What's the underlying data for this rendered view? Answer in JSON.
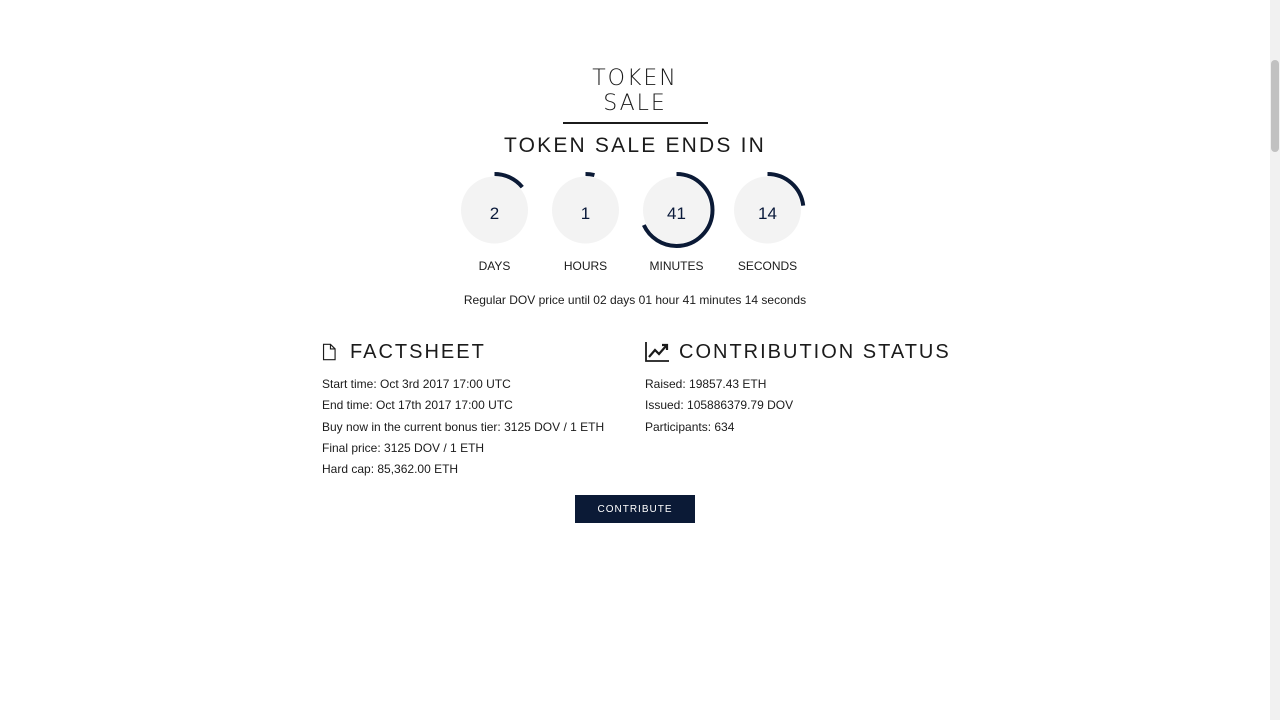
{
  "page": {
    "title": "TOKEN SALE",
    "countdown_heading": "TOKEN SALE ENDS IN"
  },
  "countdown": {
    "days": {
      "value": "2",
      "label": "DAYS",
      "progress": 0.14
    },
    "hours": {
      "value": "1",
      "label": "HOURS",
      "progress": 0.04
    },
    "minutes": {
      "value": "41",
      "label": "MINUTES",
      "progress": 0.68
    },
    "seconds": {
      "value": "14",
      "label": "SECONDS",
      "progress": 0.23
    },
    "ring_color": "#0b1a36",
    "circle_color": "#f3f3f3"
  },
  "regular_price_text": "Regular DOV price until 02 days 01 hour 41 minutes 14 seconds",
  "factsheet": {
    "heading": "FACTSHEET",
    "icon": "document-icon",
    "items": [
      "Start time: Oct 3rd 2017 17:00 UTC",
      "End time: Oct 17th 2017 17:00 UTC",
      "Buy now in the current bonus tier: 3125 DOV / 1 ETH",
      "Final price: 3125 DOV / 1 ETH",
      "Hard cap: 85,362.00 ETH"
    ]
  },
  "contribution_status": {
    "heading": "CONTRIBUTION STATUS",
    "icon": "line-chart-icon",
    "items": [
      "Raised: 19857.43 ETH",
      "Issued: 105886379.79 DOV",
      "Participants: 634"
    ]
  },
  "contribute_button": {
    "label": "CONTRIBUTE",
    "color": "#0b1a36"
  }
}
